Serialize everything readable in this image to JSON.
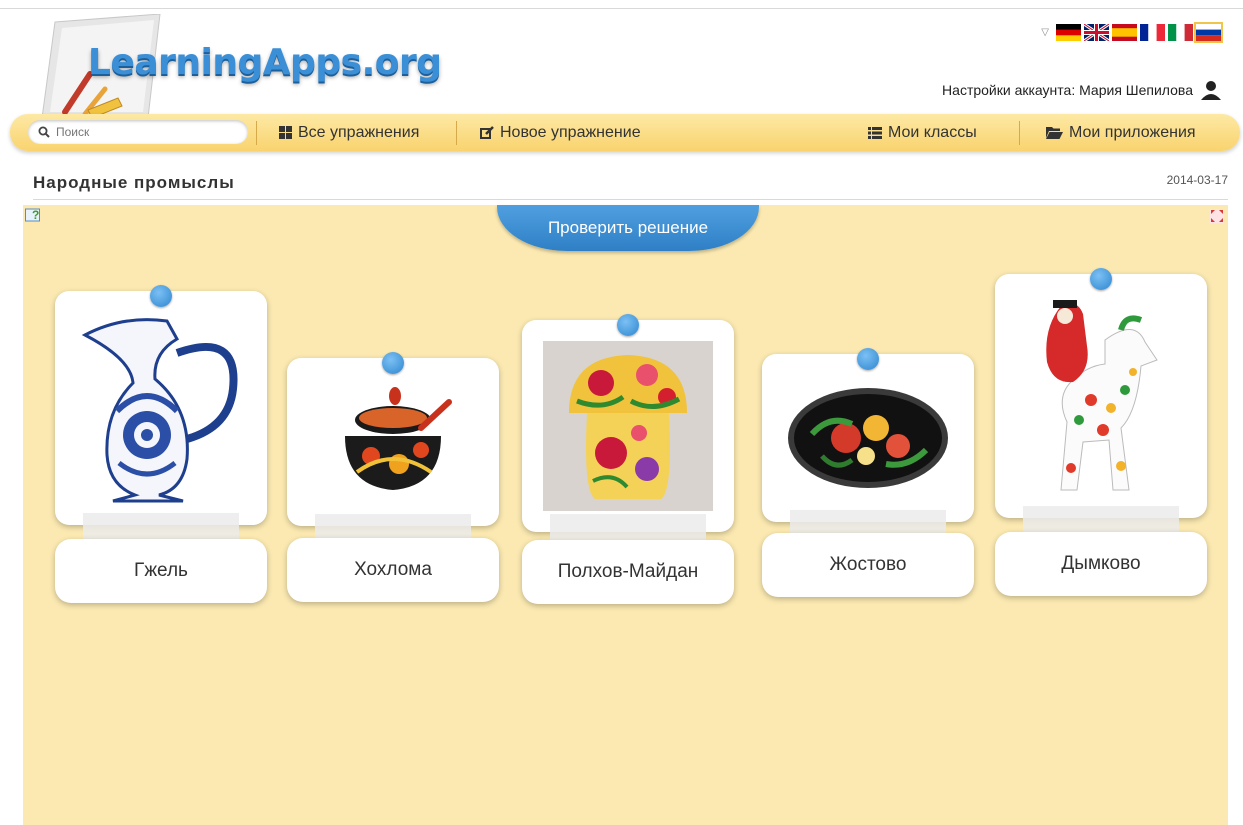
{
  "header": {
    "logo_text": "LearningApps.org",
    "account_text": "Настройки аккаунта: Мария Шепилова",
    "languages": [
      "de",
      "en",
      "es",
      "fr",
      "it",
      "ru"
    ]
  },
  "nav": {
    "search_placeholder": "Поиск",
    "all_exercises": "Все упражнения",
    "new_exercise": "Новое упражнение",
    "my_classes": "Мои классы",
    "my_apps": "Мои приложения"
  },
  "exercise": {
    "title": "Народные промыслы",
    "date": "2014-03-17",
    "check_button": "Проверить решение"
  },
  "cards": [
    {
      "label": "Гжель",
      "icon": "gzhel-jug-image"
    },
    {
      "label": "Хохлома",
      "icon": "khokhloma-bowl-image"
    },
    {
      "label": "Полхов-Майдан",
      "icon": "polkhov-maidan-mushroom-image"
    },
    {
      "label": "Жостово",
      "icon": "zhostovo-tray-image"
    },
    {
      "label": "Дымково",
      "icon": "dymkovo-toy-image"
    }
  ],
  "colors": {
    "accent_blue": "#3b8fd6",
    "navbar_yellow": "#f9d36e",
    "area_background": "#fbe9b1"
  }
}
